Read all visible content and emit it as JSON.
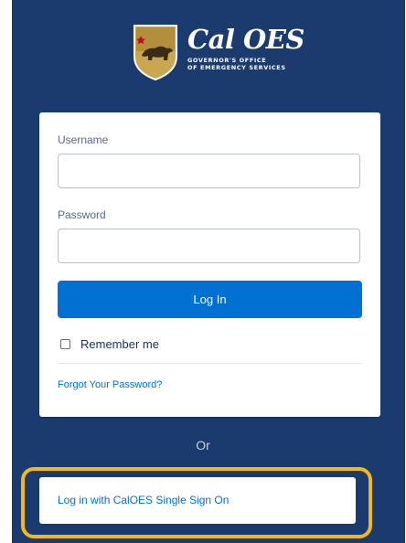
{
  "logo": {
    "title": "Cal OES",
    "subtitle_line1": "GOVERNOR'S OFFICE",
    "subtitle_line2": "OF EMERGENCY SERVICES"
  },
  "form": {
    "username_label": "Username",
    "username_value": "",
    "password_label": "Password",
    "password_value": "",
    "login_button": "Log In",
    "remember_label": "Remember me",
    "remember_checked": false,
    "forgot_link": "Forgot Your Password?"
  },
  "or_text": "Or",
  "sso_button": "Log in with CalOES Single Sign On",
  "colors": {
    "panel_background": "#1b3b6f",
    "primary_button": "#0070d2",
    "highlight_border": "#f5b81b"
  },
  "icons": [
    "shield-icon",
    "bear-icon",
    "star-icon"
  ]
}
